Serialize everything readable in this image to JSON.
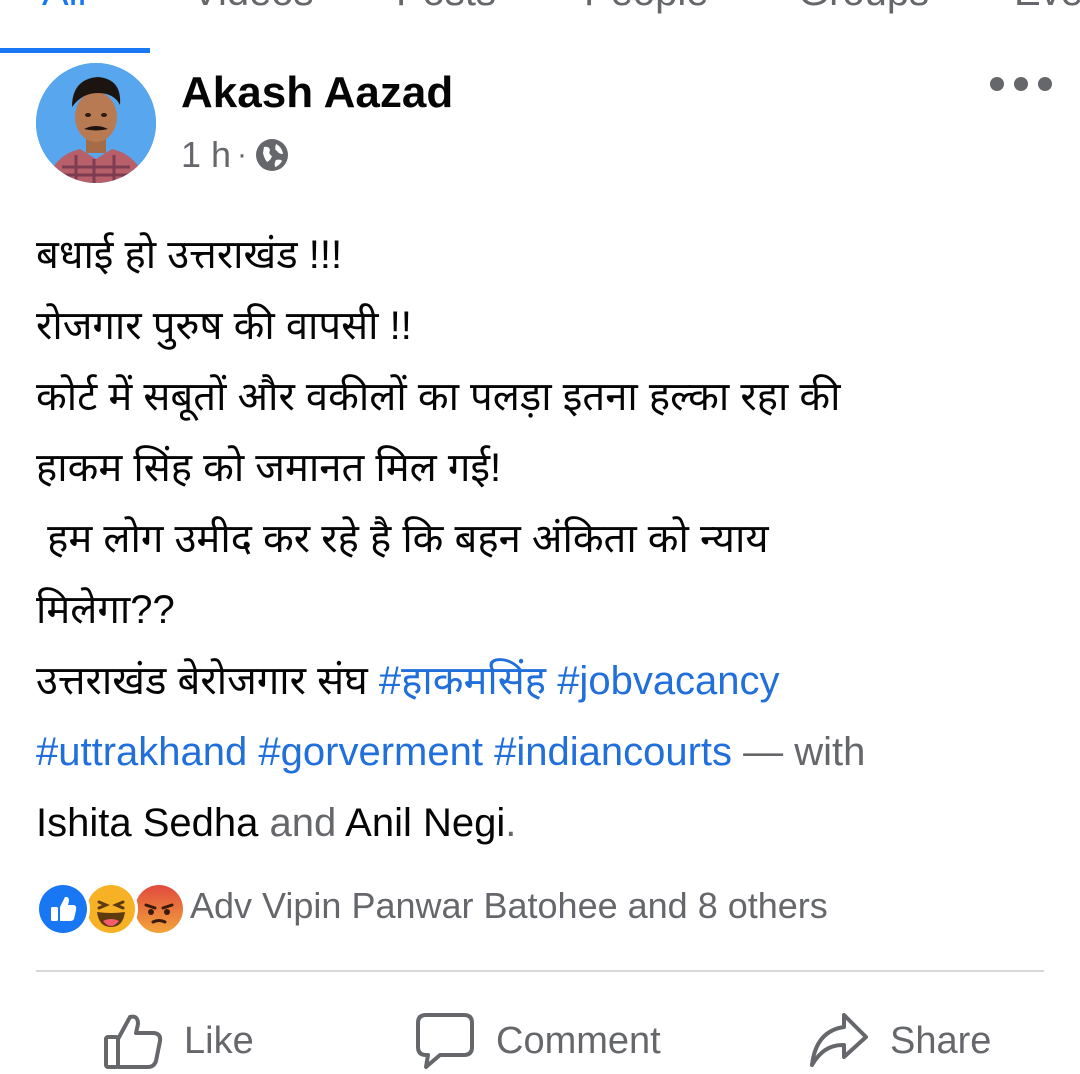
{
  "tabs": [
    {
      "label": "All",
      "active": true
    },
    {
      "label": "Videos",
      "active": false
    },
    {
      "label": "Posts",
      "active": false
    },
    {
      "label": "People",
      "active": false
    },
    {
      "label": "Groups",
      "active": false
    },
    {
      "label": "Events",
      "active": false
    }
  ],
  "post": {
    "author": "Akash Aazad",
    "time": "1 h",
    "separator": "·",
    "privacy_icon": "globe-icon",
    "more_icon": "more-options-icon",
    "body_lines": [
      "बधाई हो उत्तराखंड !!!",
      "रोजगार पुरुष की वापसी !!",
      "कोर्ट में सबूतों और वकीलों का  पलड़ा इतना हल्का रहा की",
      "हाकम सिंह को जमानत मिल गई!",
      " हम लोग उमीद कर रहे है कि बहन अंकिता को न्याय",
      "मिलेगा??"
    ],
    "footer_text": "उत्तराखंड बेरोजगार संघ",
    "hashtags": [
      "#हाकमसिंह",
      "#jobvacancy",
      "#uttrakhand",
      "#gorverment",
      "#indiancourts"
    ],
    "with_text": "— with",
    "tagged": [
      "Ishita Sedha",
      "Anil Negi"
    ],
    "and_text": "and",
    "period": ".",
    "reactions": {
      "icons": [
        "like-reaction-icon",
        "haha-reaction-icon",
        "angry-reaction-icon"
      ],
      "summary": "Adv Vipin Panwar Batohee and 8 others"
    },
    "actions": [
      {
        "label": "Like",
        "icon": "thumbs-up-icon"
      },
      {
        "label": "Comment",
        "icon": "comment-icon"
      },
      {
        "label": "Share",
        "icon": "share-icon"
      }
    ]
  },
  "colors": {
    "accent": "#1877f2",
    "hashtag": "#216fdb",
    "text": "#050505",
    "secondary_text": "#65676b",
    "divider": "#d5d7db",
    "angry": "#e9710f",
    "haha": "#f7b125"
  }
}
